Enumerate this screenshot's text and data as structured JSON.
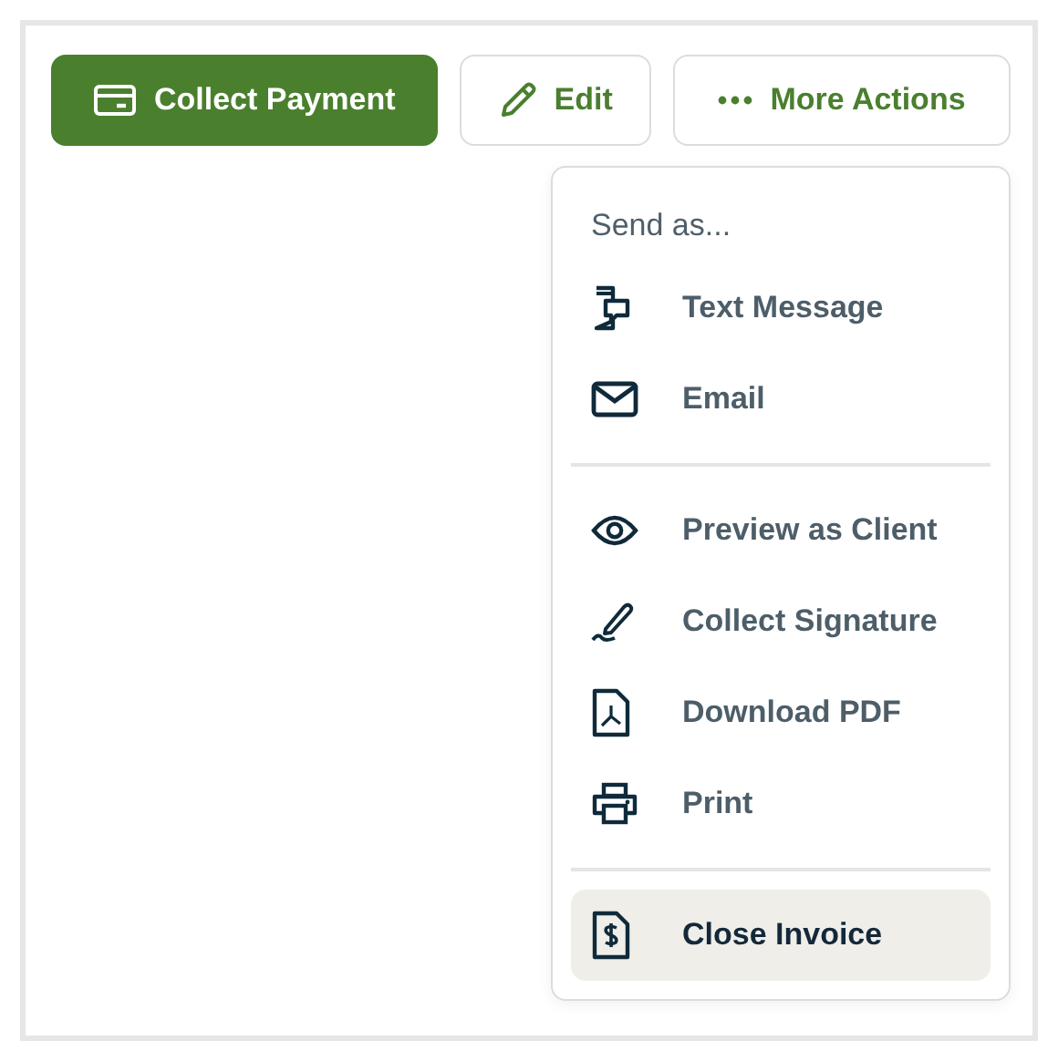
{
  "actions": [
    {
      "label": "Collect Payment",
      "kind": "primary"
    },
    {
      "label": "Edit",
      "kind": "secondary"
    },
    {
      "label": "More Actions",
      "kind": "menu"
    }
  ],
  "menu": {
    "sections": [
      {
        "heading": "Send as...",
        "items": [
          {
            "label": "Text Message",
            "selected": false
          },
          {
            "label": "Email",
            "selected": false
          }
        ]
      },
      {
        "items": [
          {
            "label": "Preview as Client",
            "selected": false
          },
          {
            "label": "Collect Signature",
            "selected": false
          },
          {
            "label": "Download PDF",
            "selected": false
          },
          {
            "label": "Print",
            "selected": false
          }
        ]
      },
      {
        "items": [
          {
            "label": "Close Invoice",
            "selected": true
          }
        ]
      }
    ]
  }
}
